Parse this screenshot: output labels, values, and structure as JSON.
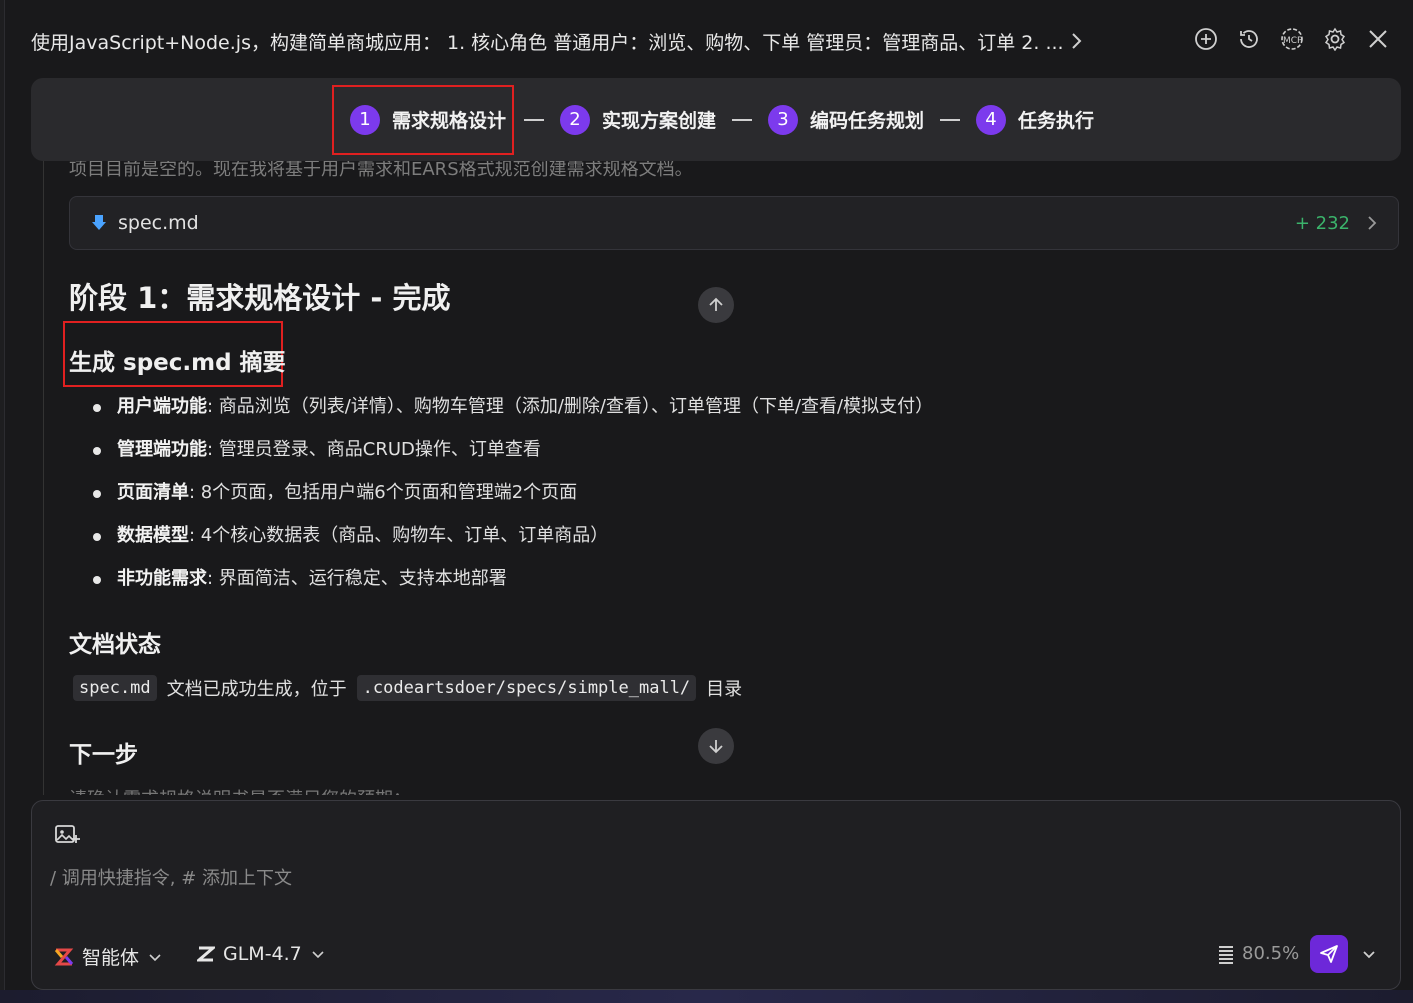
{
  "header": {
    "title": "使用JavaScript+Node.js，构建简单商城应用： 1. 核心角色 普通用户：浏览、购物、下单 管理员：管理商品、订单 2. ...",
    "icons": [
      "add-chat-icon",
      "history-icon",
      "mcp-icon",
      "settings-icon",
      "close-icon"
    ]
  },
  "steps": [
    {
      "num": "1",
      "label": "需求规格设计"
    },
    {
      "num": "2",
      "label": "实现方案创建"
    },
    {
      "num": "3",
      "label": "编码任务规划"
    },
    {
      "num": "4",
      "label": "任务执行"
    }
  ],
  "content": {
    "faded_line": "项目目前是空的。现在我将基于用户需求和EARS格式规范创建需求规格文档。",
    "file": {
      "name": "spec.md",
      "diff": "+ 232"
    },
    "section_title": "阶段 1：需求规格设计 - 完成",
    "summary_title": "生成 spec.md 摘要",
    "bullets": [
      {
        "key": "用户端功能",
        "text": ": 商品浏览（列表/详情）、购物车管理（添加/删除/查看）、订单管理（下单/查看/模拟支付）"
      },
      {
        "key": "管理端功能",
        "text": ": 管理员登录、商品CRUD操作、订单查看"
      },
      {
        "key": "页面清单",
        "text": ": 8个页面，包括用户端6个页面和管理端2个页面"
      },
      {
        "key": "数据模型",
        "text": ": 4个核心数据表（商品、购物车、订单、订单商品）"
      },
      {
        "key": "非功能需求",
        "text": ": 界面简洁、运行稳定、支持本地部署"
      }
    ],
    "status_title": "文档状态",
    "status_code1": "spec.md",
    "status_text1": "文档已成功生成，位于",
    "status_code2": ".codeartsdoer/specs/simple_mall/",
    "status_text2": "目录",
    "next_title": "下一步",
    "cut_line": "请确认需求规格说明书是否满足您的预期："
  },
  "input": {
    "placeholder": "/ 调用快捷指令, # 添加上下文",
    "agent_label": "智能体",
    "model_label": "GLM-4.7",
    "context_usage": "80.5%"
  },
  "colors": {
    "accent": "#7c3aed",
    "highlight": "#e02020",
    "diff_add": "#3bb36b"
  }
}
